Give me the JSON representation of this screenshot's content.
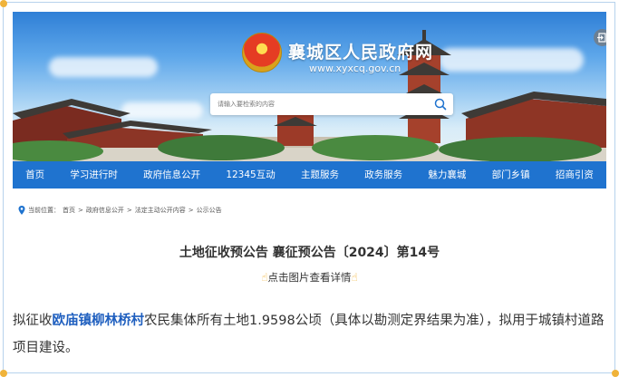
{
  "site": {
    "title": "襄城区人民政府网",
    "url": "www.xyxcq.gov.cn"
  },
  "search": {
    "placeholder": "请输入要检索的内容"
  },
  "nav": {
    "items": [
      "首页",
      "学习进行时",
      "政府信息公开",
      "12345互动",
      "主题服务",
      "政务服务",
      "魅力襄城",
      "部门乡镇",
      "招商引资"
    ]
  },
  "breadcrumb": {
    "prefix": "当前位置：",
    "items": [
      "首页",
      "政府信息公开",
      "法定主动公开内容",
      "公示公告"
    ],
    "separator": ">"
  },
  "article": {
    "title": "土地征收预公告 襄征预公告〔2024〕第14号",
    "hint": "点击图片查看详情",
    "body_pre": "拟征收",
    "body_highlight": "欧庙镇柳林桥村",
    "body_post": "农民集体所有土地1.9598公顷（具体以勘测定界结果为准），拟用于城镇村道路项目建设。"
  },
  "colors": {
    "nav_bg": "#1f73cf",
    "highlight": "#1f5fbf",
    "accent_dot": "#f0b33a"
  },
  "icons": [
    "search-icon",
    "exit-icon",
    "location-pin-icon",
    "pointing-hand-icon"
  ]
}
